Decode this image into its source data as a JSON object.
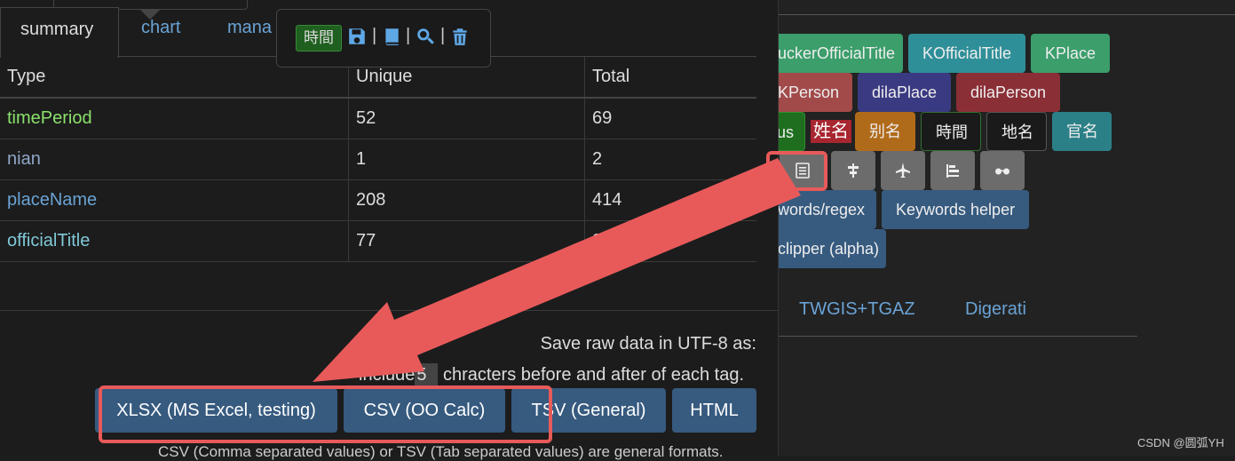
{
  "right": {
    "row1": [
      "uckerOfficialTitle",
      "KOfficialTitle",
      "KPlace"
    ],
    "row2": [
      "KPerson",
      "dilaPlace",
      "dilaPerson"
    ],
    "row3": [
      "us",
      "姓名",
      "别名",
      "時間",
      "地名",
      "官名"
    ],
    "icon_buttons": [
      "list-icon",
      "align-center-icon",
      "plane-icon",
      "align-left-icon",
      "glasses-icon"
    ],
    "btn_keywords_regex": "words/regex",
    "btn_keywords_helper": "Keywords helper",
    "btn_clipper": "clipper (alpha)",
    "links": [
      "TWGIS+TGAZ",
      "Digerati"
    ]
  },
  "tabs": [
    "summary",
    "chart",
    "mana"
  ],
  "popup": {
    "time_tag": "時間",
    "icons": [
      "save-icon",
      "book-icon",
      "search-icon",
      "trash-icon"
    ]
  },
  "table": {
    "headers": [
      "Type",
      "Unique",
      "Total"
    ],
    "rows": [
      {
        "type": "timePeriod",
        "unique": "52",
        "total": "69",
        "color": "#8be16b"
      },
      {
        "type": "nian",
        "unique": "1",
        "total": "2",
        "color": "#8fa7c9"
      },
      {
        "type": "placeName",
        "unique": "208",
        "total": "414",
        "color": "#6aa3d5"
      },
      {
        "type": "officialTitle",
        "unique": "77",
        "total": "98",
        "color": "#7fc9d8"
      }
    ]
  },
  "export": {
    "save_text": "Save raw data in UTF-8 as:",
    "include_prefix": "include",
    "include_value": "5",
    "include_suffix": "chracters before and after of each tag.",
    "buttons": [
      "XLSX (MS Excel, testing)",
      "CSV (OO Calc)",
      "TSV (General)",
      "HTML"
    ],
    "footnote": "CSV (Comma separated values) or TSV (Tab separated values) are general formats."
  },
  "watermark": "CSDN @圆弧YH"
}
